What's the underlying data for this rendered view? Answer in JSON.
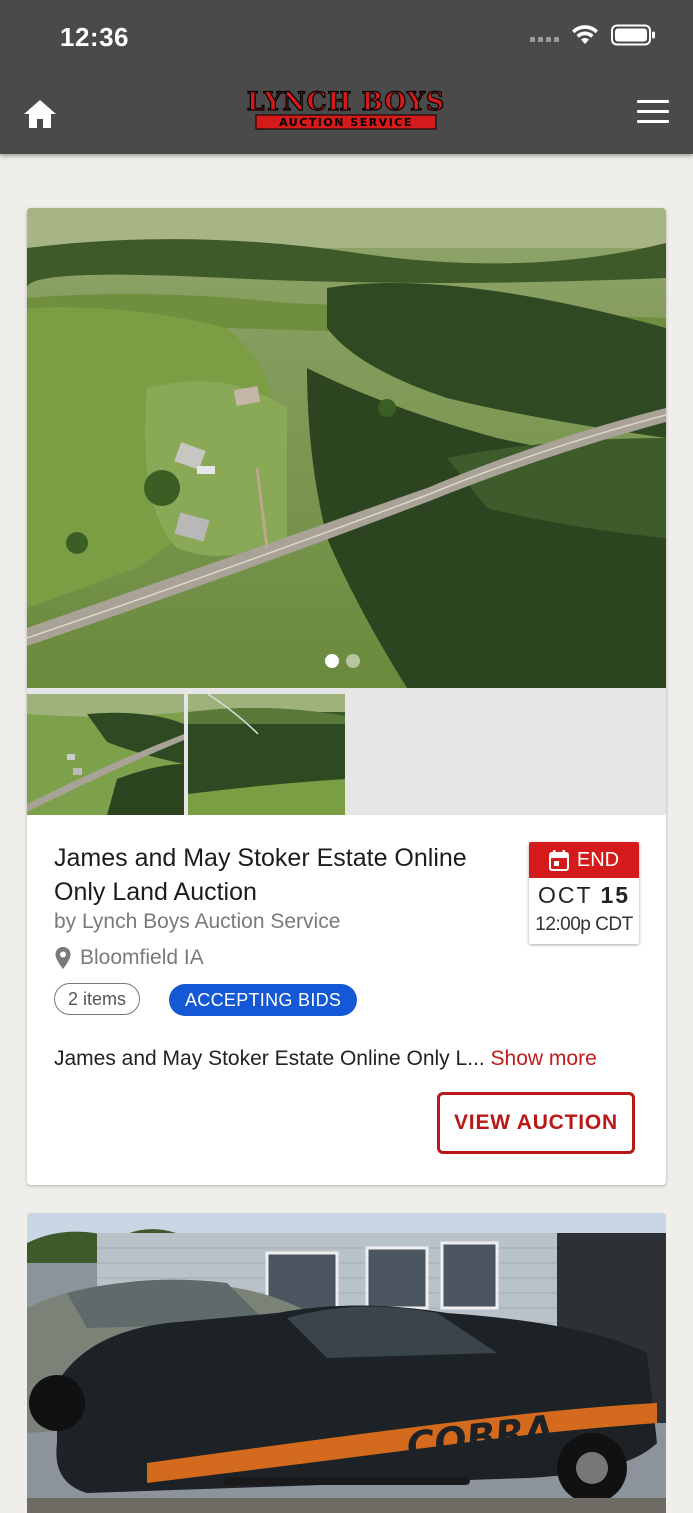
{
  "status_bar": {
    "time": "12:36"
  },
  "nav": {
    "logo_line1": "LYNCH BOYS",
    "logo_line2": "AUCTION SERVICE"
  },
  "auction": {
    "title": "James and May Stoker Estate Online Only Land Auction",
    "byline": "by Lynch Boys Auction Service",
    "location": "Bloomfield IA",
    "date_label": "END",
    "date_month": "OCT",
    "date_day": "15",
    "date_time": "12:00p CDT",
    "items_badge": "2 items",
    "status_badge": "ACCEPTING BIDS",
    "description": "James and May Stoker Estate Online Only L...",
    "show_more": "Show more",
    "view_button": "VIEW AUCTION",
    "carousel_count": 2,
    "carousel_active": 1
  },
  "colors": {
    "accent_red": "#d41a1a",
    "status_blue": "#1558d6",
    "nav_bg": "#4a4a4a"
  }
}
